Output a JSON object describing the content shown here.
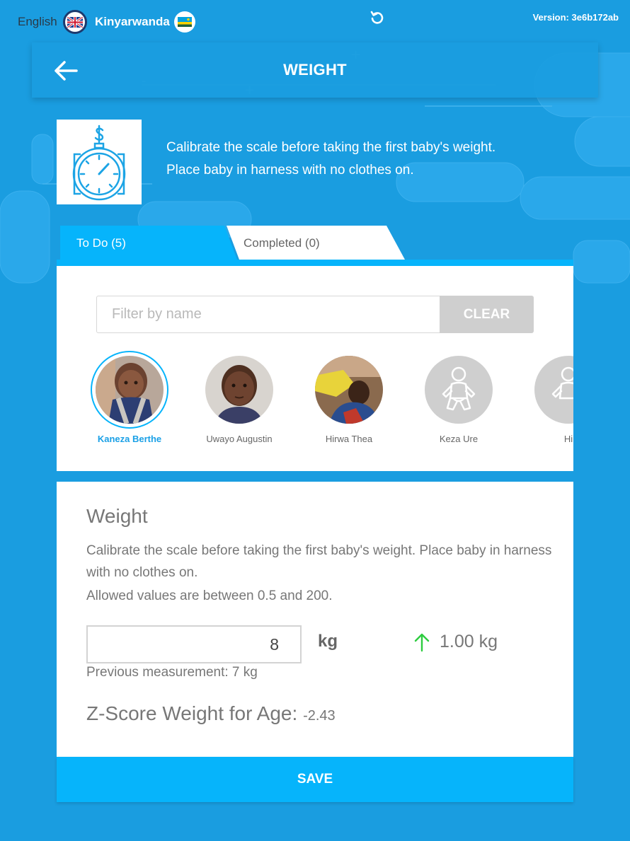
{
  "topbar": {
    "lang_english": "English",
    "lang_kinyarwanda": "Kinyarwanda",
    "version": "Version: 3e6b172ab"
  },
  "header": {
    "title": "WEIGHT"
  },
  "instruction": {
    "line1": "Calibrate the scale before taking the first baby's weight.",
    "line2": "Place baby in harness with no clothes on."
  },
  "tabs": [
    {
      "label": "To Do (5)",
      "active": true
    },
    {
      "label": "Completed (0)",
      "active": false
    }
  ],
  "filter": {
    "placeholder": "Filter by name",
    "value": "",
    "clear_label": "CLEAR"
  },
  "participants": [
    {
      "name": "Kaneza Berthe",
      "selected": true,
      "avatar": "photo"
    },
    {
      "name": "Uwayo Augustin",
      "selected": false,
      "avatar": "photo"
    },
    {
      "name": "Hirwa Thea",
      "selected": false,
      "avatar": "photo"
    },
    {
      "name": "Keza Ure",
      "selected": false,
      "avatar": "baby-placeholder-icon"
    },
    {
      "name": "Hi",
      "selected": false,
      "avatar": "baby-placeholder-icon"
    }
  ],
  "form": {
    "title": "Weight",
    "description": "Calibrate the scale before taking the first baby's weight. Place baby in harness with no clothes on.",
    "allowed": "Allowed values are between 0.5 and 200.",
    "value": "8",
    "unit": "kg",
    "change": "1.00 kg",
    "change_direction": "up",
    "previous": "Previous measurement: 7 kg",
    "zscore_label": "Z-Score Weight for Age:",
    "zscore_value": "-2.43"
  },
  "save_label": "SAVE",
  "colors": {
    "background": "#1a9de0",
    "accent": "#06b4fb",
    "selected_name": "#1aa0e6",
    "change_arrow": "#2ecc40"
  }
}
